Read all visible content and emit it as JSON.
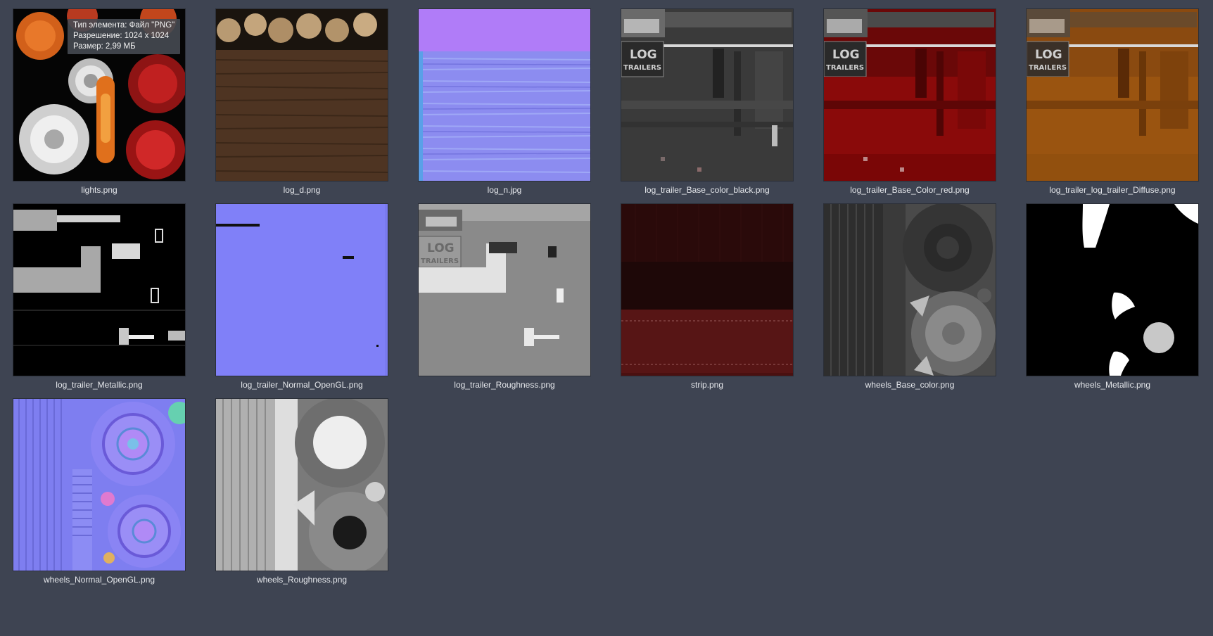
{
  "files": [
    {
      "name": "lights.png",
      "thumb": "lights-thumbnail"
    },
    {
      "name": "log_d.png",
      "thumb": "log-d-thumbnail"
    },
    {
      "name": "log_n.jpg",
      "thumb": "log-n-thumbnail"
    },
    {
      "name": "log_trailer_Base_color_black.png",
      "thumb": "trailer-black-thumbnail"
    },
    {
      "name": "log_trailer_Base_Color_red.png",
      "thumb": "trailer-red-thumbnail"
    },
    {
      "name": "log_trailer_log_trailer_Diffuse.png",
      "thumb": "trailer-diffuse-thumbnail"
    },
    {
      "name": "log_trailer_Metallic.png",
      "thumb": "trailer-metallic-thumbnail"
    },
    {
      "name": "log_trailer_Normal_OpenGL.png",
      "thumb": "trailer-normal-thumbnail"
    },
    {
      "name": "log_trailer_Roughness.png",
      "thumb": "trailer-roughness-thumbnail"
    },
    {
      "name": "strip.png",
      "thumb": "strip-thumbnail"
    },
    {
      "name": "wheels_Base_color.png",
      "thumb": "wheels-base-thumbnail"
    },
    {
      "name": "wheels_Metallic.png",
      "thumb": "wheels-metallic-thumbnail"
    },
    {
      "name": "wheels_Normal_OpenGL.png",
      "thumb": "wheels-normal-thumbnail"
    },
    {
      "name": "wheels_Roughness.png",
      "thumb": "wheels-roughness-thumbnail"
    }
  ],
  "tooltip": {
    "type": "Тип элемента: Файл \"PNG\"",
    "resolution": "Разрешение: 1024 x 1024",
    "size": "Размер: 2,99 МБ"
  },
  "texture_text": {
    "log": "LOG",
    "trailers": "TRAILERS"
  },
  "colors": {
    "background": "#3e4452",
    "caption": "#e6e8ec"
  }
}
